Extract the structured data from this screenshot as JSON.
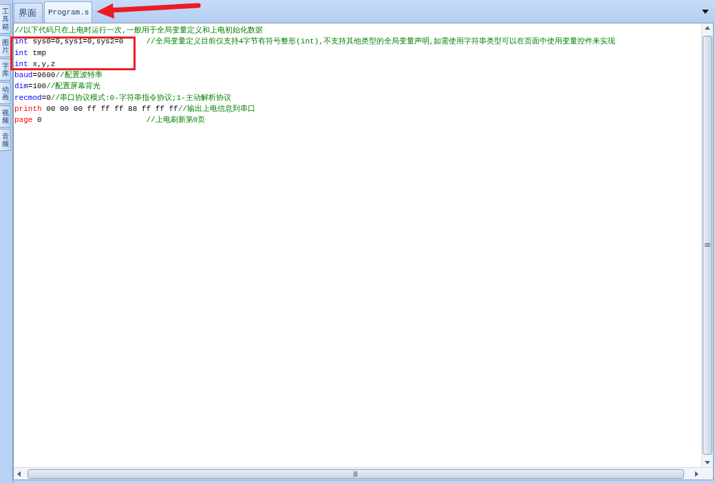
{
  "side_tabs": [
    {
      "label": "工具箱",
      "selected": false
    },
    {
      "label": "图片",
      "selected": false
    },
    {
      "label": "字库",
      "selected": false
    },
    {
      "label": "动画",
      "selected": false
    },
    {
      "label": "视频",
      "selected": false
    },
    {
      "label": "音频",
      "selected": false
    }
  ],
  "tabs": [
    {
      "label": "界面",
      "selected": false
    },
    {
      "label": "Program.s",
      "selected": true
    }
  ],
  "code_lines": [
    {
      "tokens": [
        {
          "kind": "comment",
          "text": "//以下代码只在上电时运行一次,一般用于全局变量定义和上电初始化数据"
        }
      ]
    },
    {
      "tokens": [
        {
          "kind": "keyword",
          "text": "int"
        },
        {
          "kind": "plain",
          "text": " sys0=0,sys1=0,sys2=0     "
        },
        {
          "kind": "comment",
          "text": "//全局变量定义目前仅支持4字节有符号整形(int),不支持其他类型的全局变量声明,如需使用字符串类型可以在页面中使用变量控件来实现"
        }
      ]
    },
    {
      "tokens": [
        {
          "kind": "keyword",
          "text": "int"
        },
        {
          "kind": "plain",
          "text": " tmp"
        }
      ]
    },
    {
      "tokens": [
        {
          "kind": "keyword",
          "text": "int"
        },
        {
          "kind": "plain",
          "text": " x,y,z"
        }
      ]
    },
    {
      "tokens": [
        {
          "kind": "keyword",
          "text": "baud"
        },
        {
          "kind": "plain",
          "text": "=9600"
        },
        {
          "kind": "comment",
          "text": "//配置波特率"
        }
      ]
    },
    {
      "tokens": [
        {
          "kind": "keyword",
          "text": "dim"
        },
        {
          "kind": "plain",
          "text": "=100"
        },
        {
          "kind": "comment",
          "text": "//配置屏幕背光"
        }
      ]
    },
    {
      "tokens": [
        {
          "kind": "keyword",
          "text": "recmod"
        },
        {
          "kind": "plain",
          "text": "=0"
        },
        {
          "kind": "comment",
          "text": "//串口协议模式:0-字符串指令协议;1-主动解析协议"
        }
      ]
    },
    {
      "tokens": [
        {
          "kind": "command",
          "text": "printh"
        },
        {
          "kind": "plain",
          "text": " 00 00 00 ff ff ff 88 ff ff ff"
        },
        {
          "kind": "comment",
          "text": "//输出上电信息到串口"
        }
      ]
    },
    {
      "tokens": [
        {
          "kind": "command",
          "text": "page"
        },
        {
          "kind": "plain",
          "text": " 0                       "
        },
        {
          "kind": "comment",
          "text": "//上电刷新第0页"
        }
      ]
    }
  ]
}
